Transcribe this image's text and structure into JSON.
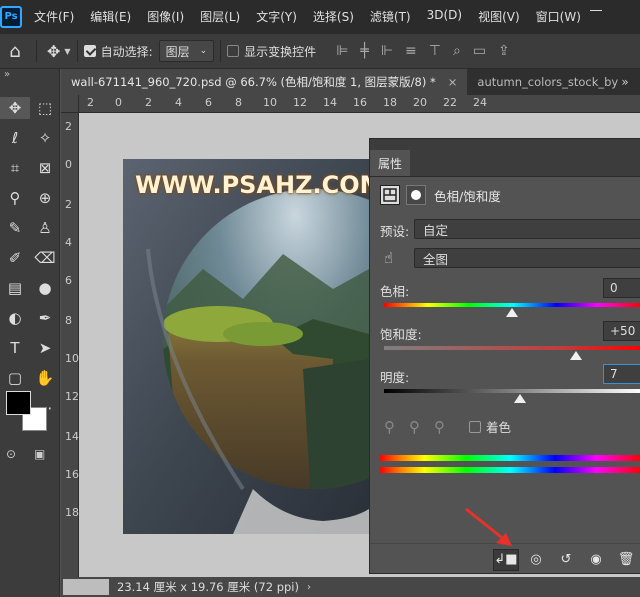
{
  "app": {
    "logo": "Ps"
  },
  "menu": [
    "文件(F)",
    "编辑(E)",
    "图像(I)",
    "图层(L)",
    "文字(Y)",
    "选择(S)",
    "滤镜(T)",
    "3D(D)",
    "视图(V)",
    "窗口(W)"
  ],
  "options_bar": {
    "auto_select_label": "自动选择:",
    "auto_select_checked": true,
    "auto_select_target": "图层",
    "show_transform_label": "显示变换控件",
    "show_transform_checked": false
  },
  "tabs": [
    {
      "label": "wall-671141_960_720.psd @ 66.7% (色相/饱和度 1, 图层蒙版/8) *",
      "active": true,
      "close": "×"
    },
    {
      "label": "autumn_colors_stock_by",
      "active": false
    }
  ],
  "tab_more": "»",
  "ruler_top": [
    "2",
    "0",
    "2",
    "4",
    "6",
    "8",
    "10",
    "12",
    "14",
    "16",
    "18",
    "20",
    "22",
    "24"
  ],
  "ruler_left": [
    "2",
    "0",
    "2",
    "4",
    "6",
    "8",
    "10",
    "12",
    "14",
    "16",
    "18"
  ],
  "document": {
    "watermark": "WWW.PSAHZ.COM"
  },
  "status": {
    "text": "23.14 厘米 x 19.76 厘米 (72 ppi)",
    "arrow": "›"
  },
  "properties": {
    "tab_label": "属性",
    "title": "色相/饱和度",
    "preset_label": "预设:",
    "preset_value": "自定",
    "channel_value": "全图",
    "hue_label": "色相:",
    "hue_value": "0",
    "hue": 0,
    "saturation_label": "饱和度:",
    "saturation_value": "+50",
    "saturation": 50,
    "lightness_label": "明度:",
    "lightness_value": "7",
    "lightness": 7,
    "colorize_label": "着色",
    "colorize_checked": false
  },
  "colors": {
    "accent": "#3b8fd9",
    "annotation_arrow": "#e8312a"
  }
}
